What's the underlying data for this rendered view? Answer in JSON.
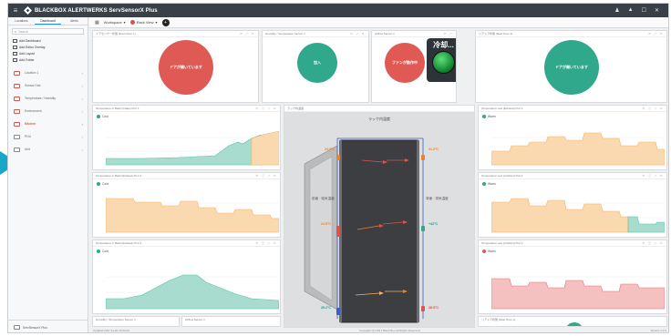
{
  "app": {
    "title": "BLACKBOX ALERTWERKS ServSensorX Plus"
  },
  "sidebar": {
    "tabs": [
      "Locations",
      "Dashboard",
      "Alerts"
    ],
    "search_placeholder": "Search",
    "items": [
      {
        "label": "Add Dashboard"
      },
      {
        "label": "Add Editor Overlay"
      },
      {
        "label": "Add Layout"
      },
      {
        "label": "Add Folder"
      }
    ],
    "devices": [
      {
        "label": "Location 1",
        "state": "alert"
      },
      {
        "label": "Sensor Hub",
        "state": "alert"
      },
      {
        "label": "Temperature / Humidity",
        "state": "normal"
      },
      {
        "label": "Environment",
        "state": "alert"
      },
      {
        "label": "Kitchen",
        "state": "selected"
      },
      {
        "label": "PDU",
        "state": "normal"
      },
      {
        "label": "Unit",
        "state": "normal"
      }
    ],
    "footer_label": "ServSensorX Plus"
  },
  "toolbar": {
    "location_label": "Workspace",
    "status_label": "Rack View"
  },
  "top_panels": {
    "p1": {
      "title": "ドアセンサー状態 (Front Door 1)",
      "circle_text": "ドアが開いています",
      "color": "#e05a55"
    },
    "p2": {
      "title": "Humidity / Temperature Sensor 1",
      "circle_text": "加入",
      "color": "#2fa88c"
    },
    "p3": {
      "title": "Airflow Sensor 1",
      "circle_text": "ファンが動作中",
      "color": "#e05a55"
    },
    "p4": {
      "title": "リアドア状態 (Rear Door 1)",
      "circle_text": "ドアが開いています",
      "color": "#2fa88c"
    },
    "cooling_label": "冷却..."
  },
  "rack": {
    "title": "ラック内温度",
    "left_label": "前面 · 吸気温度",
    "right_label": "背面 · 排気温度",
    "front_top": "24.5°C",
    "front_mid": "24.8°C",
    "front_bot": "25.2°C",
    "rear_top": "31.2°C",
    "rear_mid": "+42°C",
    "rear_bot": "28.5°C"
  },
  "charts": {
    "left_top": {
      "title": "Temperature in Rack (Intake) Port 1",
      "legend": "Cold"
    },
    "left_mid": {
      "title": "Temperature in Rack (Exhaust) Port 1",
      "legend": "Cold"
    },
    "left_bot": {
      "title": "Temperature in Rack (Exhaust) Port 1",
      "legend": "Cold"
    },
    "right_top": {
      "title": "Temperature rear (Exhaust) Port 1",
      "legend": "Warm"
    },
    "right_mid": {
      "title": "Temperature rear (Ambient) Port 1",
      "legend": "Warm"
    },
    "right_bot": {
      "title": "Temperature rear (Ambient) Port 1",
      "legend": "Warm"
    }
  },
  "footer": {
    "left": "Updated 2017-11-20 10:00:00",
    "center": "Copyright (C) 2017 Black Box All Rights Reserved.",
    "right": "Version 1.2.0"
  },
  "colors": {
    "accent": "#1aa7c7",
    "red": "#e05a55",
    "teal": "#2fa88c",
    "dark": "#3a4047"
  }
}
